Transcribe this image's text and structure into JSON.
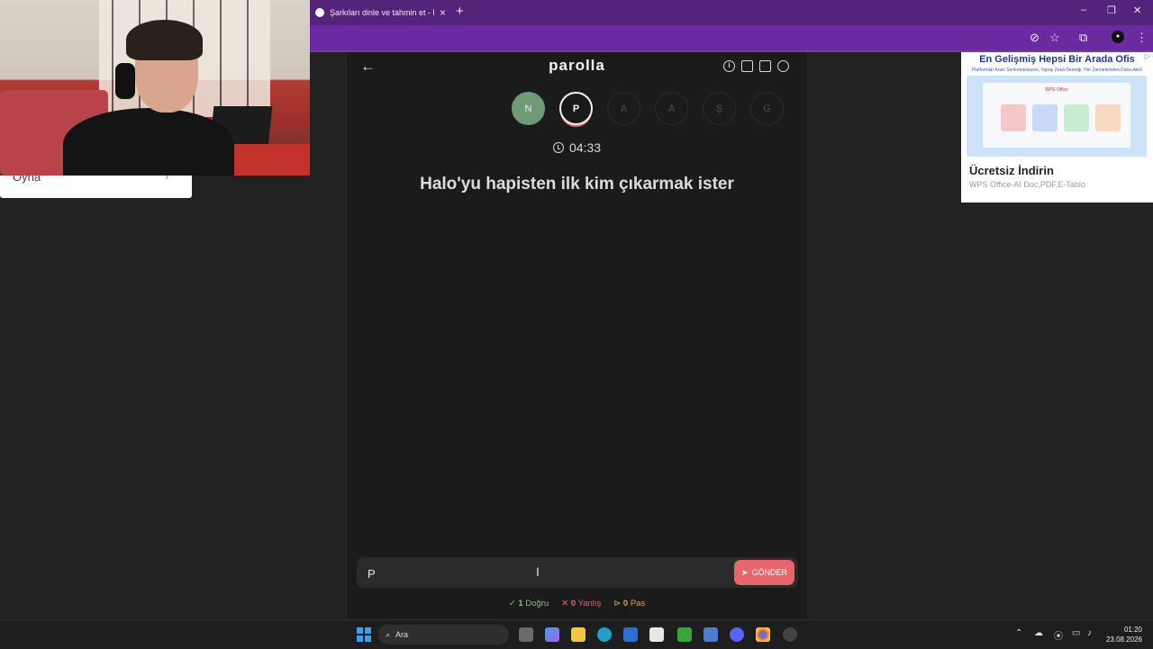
{
  "browser": {
    "tab_title": "Şarkıları dinle ve tahmin et - M",
    "new_tab": "+",
    "tab_close": "×",
    "controls": [
      "–",
      "❐",
      "✕"
    ]
  },
  "left_panel": {
    "label": "Oyna",
    "chevron": "›"
  },
  "game": {
    "logo": "parolla",
    "back_icon": "←",
    "letters": [
      {
        "letter": "N",
        "state": "done"
      },
      {
        "letter": "P",
        "state": "active"
      },
      {
        "letter": "A",
        "state": "pending"
      },
      {
        "letter": "A",
        "state": "pending"
      },
      {
        "letter": "Ş",
        "state": "pending"
      },
      {
        "letter": "G",
        "state": "pending"
      }
    ],
    "timer": "04:33",
    "question": "Halo'yu hapisten ilk kim çıkarmak ister",
    "answer_value": "P",
    "send_label": "GÖNDER",
    "stats": {
      "correct_count": "1",
      "correct_label": "Doğru",
      "wrong_count": "0",
      "wrong_label": "Yanlış",
      "pass_count": "0",
      "pass_label": "Pas"
    }
  },
  "ad": {
    "headline": "En Gelişmiş Hepsi Bir Arada Ofis",
    "subline": "Platformlar Arası Senkronizasyon, Yapay Zekâ Desteği, Her Zamankinden Daha Akıllı",
    "cta": "Ücretsiz İndirin",
    "description": "WPS Office-AI Doc,PDF,E-Tablo",
    "window_title": "WPS Office"
  },
  "taskbar": {
    "search_placeholder": "Ara",
    "time": "01:20",
    "date": "23.08.2026"
  },
  "colors": {
    "accent": "#e9656d",
    "done": "#6e9a77",
    "browser": "#6a2ba0"
  }
}
